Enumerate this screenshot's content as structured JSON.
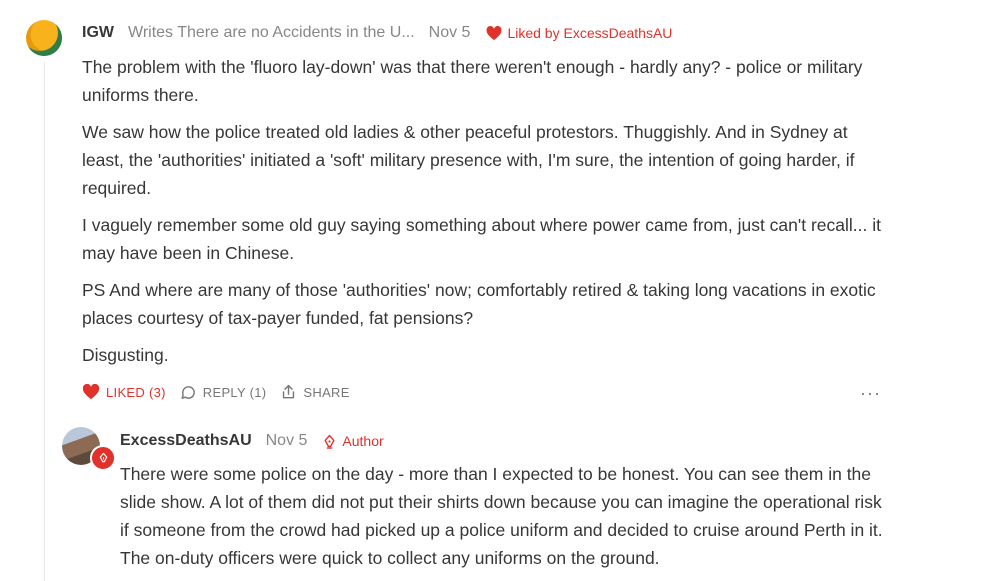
{
  "comment": {
    "author": "IGW",
    "bio": "Writes There are no Accidents in the U...",
    "date": "Nov 5",
    "liked_by": "Liked by ExcessDeathsAU",
    "paragraphs": [
      "The problem with the 'fluoro lay-down' was that there weren't enough - hardly any? - police or military uniforms there.",
      "We saw how the police treated old ladies & other peaceful protestors. Thuggishly. And in Sydney at least, the 'authorities' initiated a 'soft' military presence with, I'm sure, the intention of going harder, if required.",
      "I vaguely remember some old guy saying something about where power came from, just can't recall... it may have been in Chinese.",
      "PS And where are many of those 'authorities' now; comfortably retired & taking long vacations in exotic places courtesy of tax-payer funded, fat pensions?",
      "Disgusting."
    ],
    "actions": {
      "liked_label": "LIKED (3)",
      "reply_label": "REPLY (1)",
      "share_label": "SHARE",
      "more_label": "···"
    }
  },
  "reply": {
    "author": "ExcessDeathsAU",
    "date": "Nov 5",
    "author_tag": "Author",
    "text": "There were some police on the day - more than I expected to be honest. You can see them in the slide show. A lot of them did not put their shirts down because you can imagine the operational risk if someone from the crowd had picked up a police uniform and decided to cruise around Perth in it. The on-duty officers were quick to collect any uniforms on the ground."
  },
  "colors": {
    "accent_red": "#e0322b",
    "text": "#363737",
    "muted": "#868787"
  },
  "icons": [
    "heart-icon",
    "comment-bubble-icon",
    "share-icon",
    "more-icon",
    "pen-nib-icon"
  ]
}
